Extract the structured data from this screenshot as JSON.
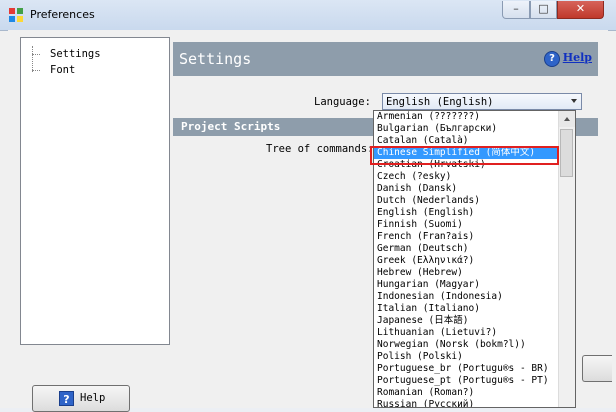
{
  "window": {
    "title": "Preferences",
    "controls": {
      "minimize": "–",
      "maximize": "□",
      "close": "✕"
    }
  },
  "tree": {
    "items": [
      "Settings",
      "Font"
    ]
  },
  "settings": {
    "title": "Settings",
    "help_link": "Help",
    "language_label": "Language:",
    "language_value": "English (English)",
    "section_title": "Project Scripts",
    "tree_commands_label": "Tree of commands:"
  },
  "dropdown": {
    "selected_index": 3,
    "items": [
      "Armenian (???????)",
      "Bulgarian (Български)",
      "Catalan (Català)",
      "Chinese Simplified (简体中文)",
      "Croatian (Hrvatski)",
      "Czech (?esky)",
      "Danish (Dansk)",
      "Dutch (Nederlands)",
      "English (English)",
      "Finnish (Suomi)",
      "French (Fran?ais)",
      "German (Deutsch)",
      "Greek (Ελληνικά?)",
      "Hebrew (Hebrew)",
      "Hungarian (Magyar)",
      "Indonesian (Indonesia)",
      "Italian (Italiano)",
      "Japanese (日本語)",
      "Lithuanian (Lietuvi?)",
      "Norwegian (Norsk (bokm?l))",
      "Polish (Polski)",
      "Portuguese_br (Portugu®s - BR)",
      "Portuguese_pt (Portugu®s - PT)",
      "Romanian (Roman?)",
      "Russian (Русский)"
    ]
  },
  "footer": {
    "help_button": "Help",
    "help_icon": "?"
  },
  "icons": {
    "help": "help-icon",
    "app": "preferences-app-icon"
  },
  "colors": {
    "header_bg": "#8e9dab",
    "selection": "#3399ff",
    "highlight_box": "#e02020"
  }
}
